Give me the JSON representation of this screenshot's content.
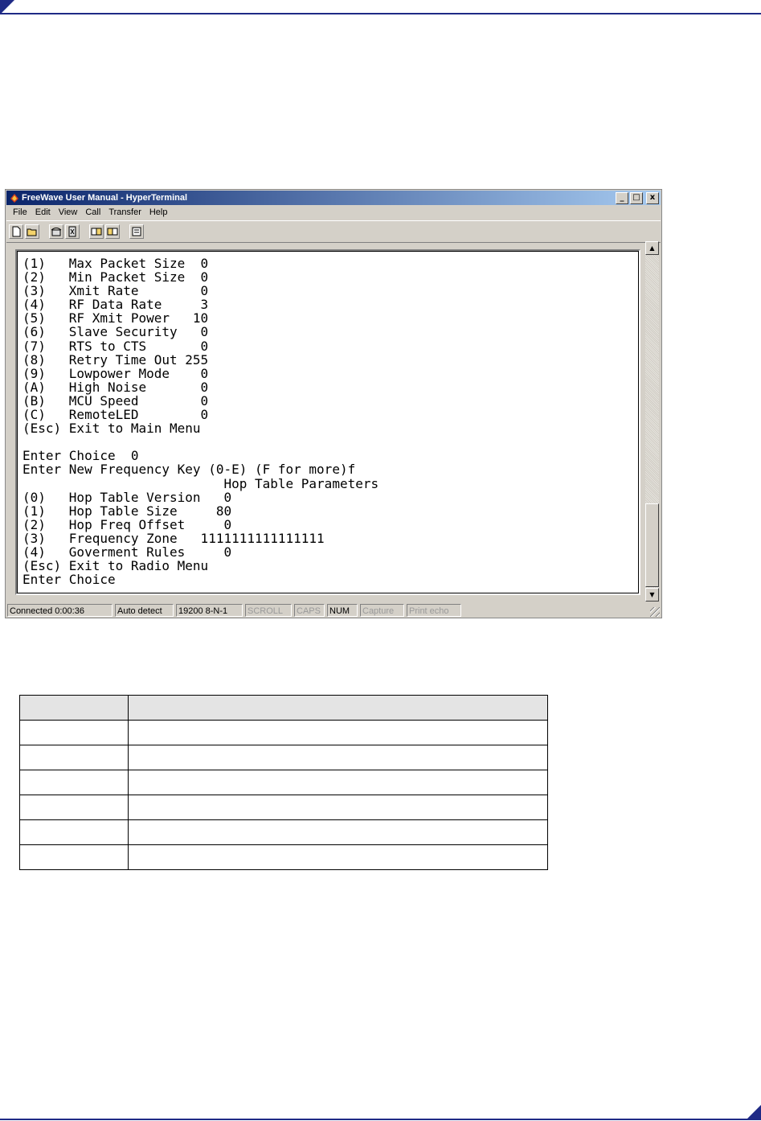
{
  "window": {
    "title": "FreeWave User Manual - HyperTerminal",
    "controls": [
      "_",
      "□",
      "x"
    ]
  },
  "menu": [
    "File",
    "Edit",
    "View",
    "Call",
    "Transfer",
    "Help"
  ],
  "toolbar_icons": [
    "new-icon",
    "open-icon",
    "phone-connect-icon",
    "disconnect-icon",
    "send-icon",
    "receive-icon",
    "properties-icon"
  ],
  "terminal": {
    "lines": [
      "(1)   Max Packet Size  0",
      "(2)   Min Packet Size  0",
      "(3)   Xmit Rate        0",
      "(4)   RF Data Rate     3",
      "(5)   RF Xmit Power   10",
      "(6)   Slave Security   0",
      "(7)   RTS to CTS       0",
      "(8)   Retry Time Out 255",
      "(9)   Lowpower Mode    0",
      "(A)   High Noise       0",
      "(B)   MCU Speed        0",
      "(C)   RemoteLED        0",
      "(Esc) Exit to Main Menu",
      "",
      "Enter Choice  0",
      "Enter New Frequency Key (0-E) (F for more)f",
      "                          Hop Table Parameters",
      "(0)   Hop Table Version   0",
      "(1)   Hop Table Size     80",
      "(2)   Hop Freq Offset     0",
      "(3)   Frequency Zone   1111111111111111",
      "(4)   Goverment Rules     0",
      "(Esc) Exit to Radio Menu",
      "Enter Choice"
    ]
  },
  "status": {
    "connected": "Connected 0:00:36",
    "detect": "Auto detect",
    "port": "19200 8-N-1",
    "scroll": "SCROLL",
    "caps": "CAPS",
    "num": "NUM",
    "capture": "Capture",
    "print_echo": "Print echo"
  },
  "colors": {
    "header_blue": "#1f2a86",
    "title_active_start": "#0a246a",
    "title_active_end": "#a6caf0",
    "window_face": "#d4d0c8"
  },
  "table": {
    "header": [
      "",
      ""
    ],
    "rows": [
      [
        "",
        ""
      ],
      [
        "",
        ""
      ],
      [
        "",
        ""
      ],
      [
        "",
        ""
      ],
      [
        "",
        ""
      ],
      [
        "",
        ""
      ]
    ]
  }
}
